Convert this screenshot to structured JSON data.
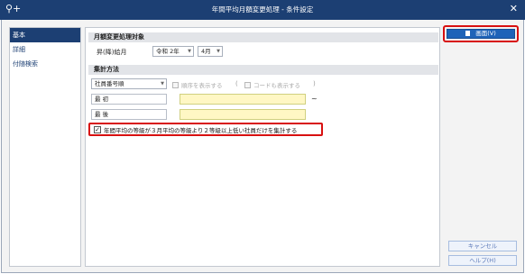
{
  "window": {
    "title": "年間平均月額変更処理 - 条件設定",
    "close_symbol": "✕",
    "app_icon_symbol": "⚲+"
  },
  "sidebar": {
    "items": [
      {
        "label": "基本",
        "active": true
      },
      {
        "label": "詳細",
        "active": false
      },
      {
        "label": "付随検索",
        "active": false
      }
    ]
  },
  "target_section": {
    "header": "月額変更処理対象",
    "date_label": "昇(降)給月",
    "era_value": "令和 2年",
    "month_value": "4月"
  },
  "aggregation_section": {
    "header": "集計方法",
    "order_select": "社員番号順",
    "show_order_checkbox": "順序を表示する",
    "paren_open": "(",
    "paren_close": ")",
    "show_code_checkbox": "コードも表示する",
    "first_label": "最 初",
    "last_label": "最 後",
    "range_separator": "~",
    "first_value": "",
    "last_value": "",
    "grade_condition": {
      "checked": true,
      "check_mark": "✓",
      "label": "年間平均の等級が３月平均の等級より２等級以上低い社員だけを集計する"
    }
  },
  "buttons": {
    "print_label": "画面(V)",
    "cancel_label": "キャンセル",
    "help_label": "ヘルプ(H)"
  },
  "colors": {
    "titlebar": "#1c3f73",
    "primary_button": "#1e63b8",
    "highlight": "#d81010",
    "input_yellow": "#fff7c4"
  }
}
